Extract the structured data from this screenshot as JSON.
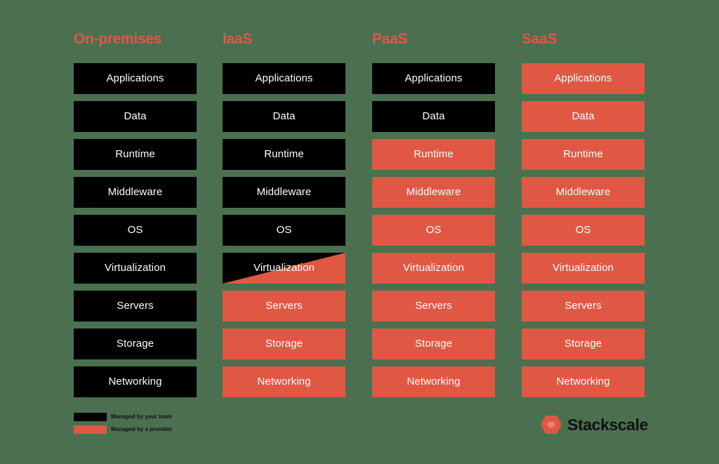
{
  "background_color": "#4a7050",
  "colors": {
    "team": "#000000",
    "provider": "#e05844",
    "label_text": "#ffffff",
    "title": "#e05844",
    "legend_text": "#111111",
    "logo_text": "#111111"
  },
  "chart_data": {
    "type": "table",
    "title": "",
    "categories": [
      "On-premises",
      "IaaS",
      "PaaS",
      "SaaS"
    ],
    "layers": [
      "Applications",
      "Data",
      "Runtime",
      "Middleware",
      "OS",
      "Virtualization",
      "Servers",
      "Storage",
      "Networking"
    ],
    "legend": [
      "Managed by your team",
      "Managed by a provider"
    ],
    "series": [
      {
        "name": "On-premises",
        "values": [
          "team",
          "team",
          "team",
          "team",
          "team",
          "team",
          "team",
          "team",
          "team"
        ]
      },
      {
        "name": "IaaS",
        "values": [
          "team",
          "team",
          "team",
          "team",
          "team",
          "split",
          "provider",
          "provider",
          "provider"
        ]
      },
      {
        "name": "PaaS",
        "values": [
          "team",
          "team",
          "provider",
          "provider",
          "provider",
          "provider",
          "provider",
          "provider",
          "provider"
        ]
      },
      {
        "name": "SaaS",
        "values": [
          "provider",
          "provider",
          "provider",
          "provider",
          "provider",
          "provider",
          "provider",
          "provider",
          "provider"
        ]
      }
    ]
  },
  "columns": [
    {
      "id": "on-premises",
      "title": "On-premises",
      "layers": [
        {
          "label": "Applications",
          "owner": "team"
        },
        {
          "label": "Data",
          "owner": "team"
        },
        {
          "label": "Runtime",
          "owner": "team"
        },
        {
          "label": "Middleware",
          "owner": "team"
        },
        {
          "label": "OS",
          "owner": "team"
        },
        {
          "label": "Virtualization",
          "owner": "team"
        },
        {
          "label": "Servers",
          "owner": "team"
        },
        {
          "label": "Storage",
          "owner": "team"
        },
        {
          "label": "Networking",
          "owner": "team"
        }
      ]
    },
    {
      "id": "iaas",
      "title": "IaaS",
      "layers": [
        {
          "label": "Applications",
          "owner": "team"
        },
        {
          "label": "Data",
          "owner": "team"
        },
        {
          "label": "Runtime",
          "owner": "team"
        },
        {
          "label": "Middleware",
          "owner": "team"
        },
        {
          "label": "OS",
          "owner": "team"
        },
        {
          "label": "Virtualization",
          "owner": "split"
        },
        {
          "label": "Servers",
          "owner": "provider"
        },
        {
          "label": "Storage",
          "owner": "provider"
        },
        {
          "label": "Networking",
          "owner": "provider"
        }
      ]
    },
    {
      "id": "paas",
      "title": "PaaS",
      "layers": [
        {
          "label": "Applications",
          "owner": "team"
        },
        {
          "label": "Data",
          "owner": "team"
        },
        {
          "label": "Runtime",
          "owner": "provider"
        },
        {
          "label": "Middleware",
          "owner": "provider"
        },
        {
          "label": "OS",
          "owner": "provider"
        },
        {
          "label": "Virtualization",
          "owner": "provider"
        },
        {
          "label": "Servers",
          "owner": "provider"
        },
        {
          "label": "Storage",
          "owner": "provider"
        },
        {
          "label": "Networking",
          "owner": "provider"
        }
      ]
    },
    {
      "id": "saas",
      "title": "SaaS",
      "layers": [
        {
          "label": "Applications",
          "owner": "provider"
        },
        {
          "label": "Data",
          "owner": "provider"
        },
        {
          "label": "Runtime",
          "owner": "provider"
        },
        {
          "label": "Middleware",
          "owner": "provider"
        },
        {
          "label": "OS",
          "owner": "provider"
        },
        {
          "label": "Virtualization",
          "owner": "provider"
        },
        {
          "label": "Servers",
          "owner": "provider"
        },
        {
          "label": "Storage",
          "owner": "provider"
        },
        {
          "label": "Networking",
          "owner": "provider"
        }
      ]
    }
  ],
  "legend": {
    "items": [
      {
        "owner": "team",
        "label": "Managed by your team"
      },
      {
        "owner": "provider",
        "label": "Managed by a provider"
      }
    ]
  },
  "logo": {
    "icon": "stackscale-hexagon-icon",
    "wordmark": "Stackscale"
  }
}
